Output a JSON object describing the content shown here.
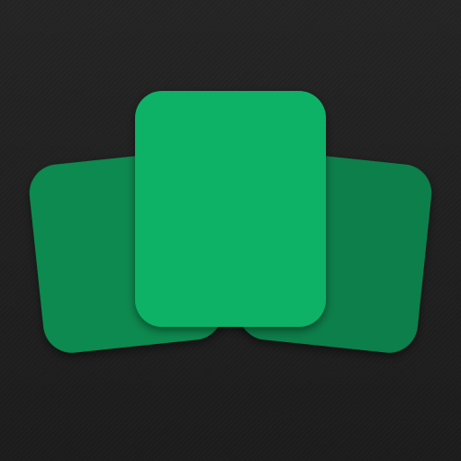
{
  "app_icon": {
    "semantic": "card-stack-icon",
    "background_color": "#1f1f1f",
    "cards": [
      {
        "role": "back-left",
        "color": "#0f8a50"
      },
      {
        "role": "back-right",
        "color": "#0f7f4c"
      },
      {
        "role": "front",
        "color": "#08b266"
      }
    ],
    "shadow_color": "#000000"
  }
}
